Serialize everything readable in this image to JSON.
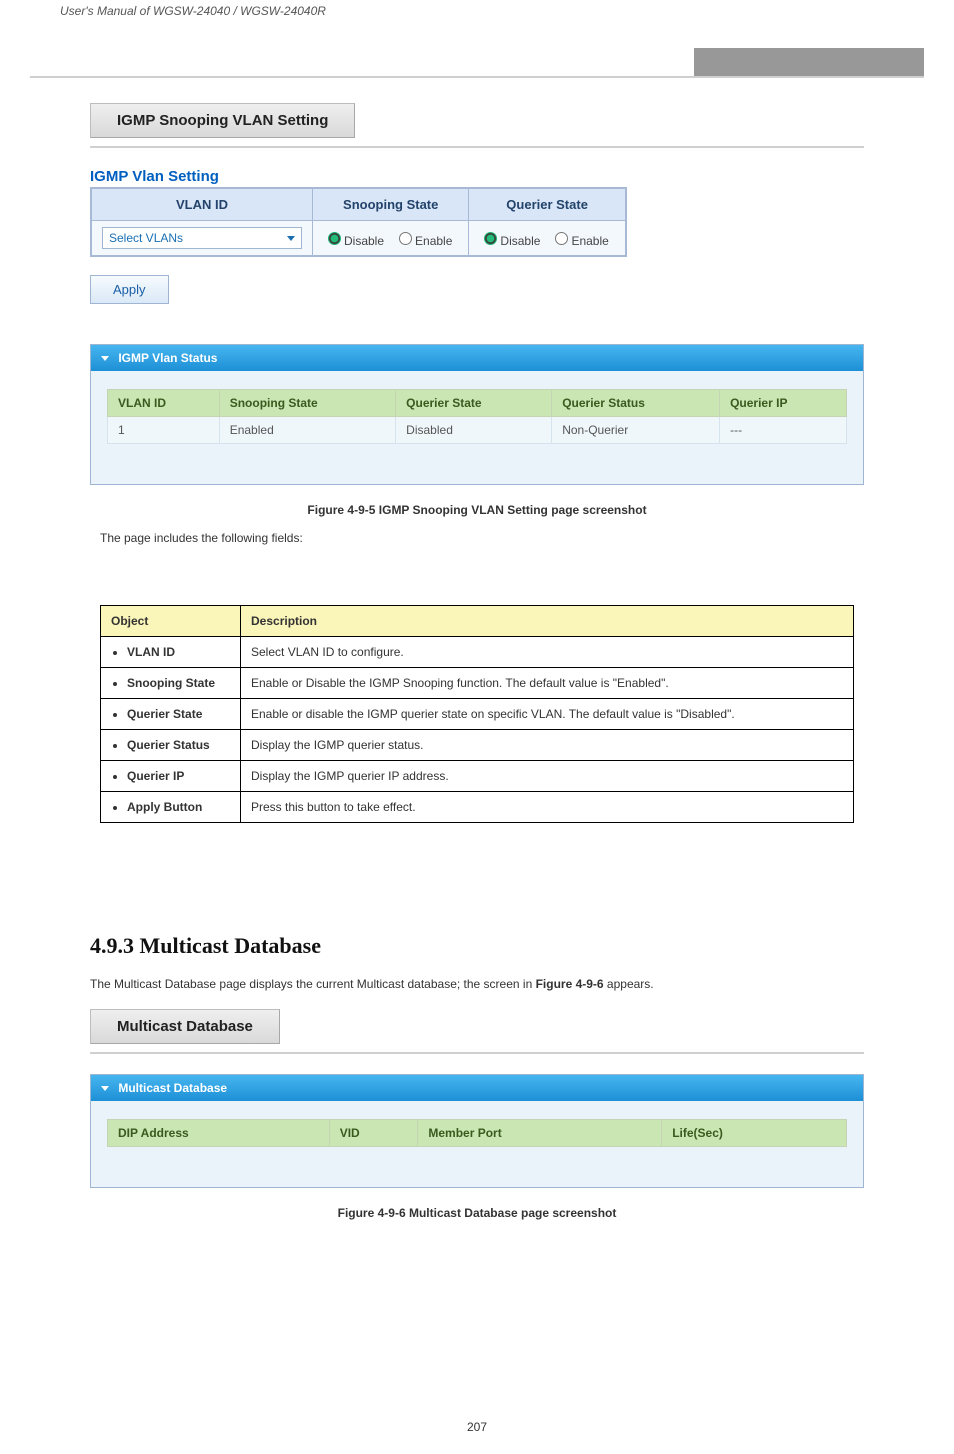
{
  "doc_title_italic": "User's Manual of WGSW-24040 / WGSW-24040R",
  "section1": {
    "title": "IGMP Snooping VLAN Setting",
    "form_title": "IGMP Vlan Setting",
    "headers": {
      "vlan_id": "VLAN ID",
      "snooping": "Snooping State",
      "querier": "Querier State"
    },
    "select_placeholder": "Select VLANs",
    "radio": {
      "disable": "Disable",
      "enable": "Enable"
    },
    "apply": "Apply",
    "status_panel_title": "IGMP Vlan Status",
    "status_headers": {
      "vlan_id": "VLAN ID",
      "snooping": "Snooping State",
      "querier": "Querier State",
      "qstatus": "Querier Status",
      "qip": "Querier IP"
    },
    "status_row": {
      "vlan_id": "1",
      "snooping": "Enabled",
      "querier": "Disabled",
      "qstatus": "Non-Querier",
      "qip": "---"
    },
    "figure_caption": "Figure 4-9-5 IGMP Snooping VLAN Setting page screenshot",
    "lead_in": "The page includes the following fields:"
  },
  "obj_table": {
    "head": {
      "obj": "Object",
      "desc": "Description"
    },
    "rows": [
      {
        "obj": "VLAN ID",
        "desc_prefix": "Select ",
        "desc_link": "VLAN",
        "desc_suffix": " ID to configure."
      },
      {
        "obj": "Snooping State",
        "desc": "Enable or Disable the IGMP Snooping function. The default value is \"Enabled\"."
      },
      {
        "obj": "Querier State",
        "desc": "Enable or disable the IGMP querier state on specific VLAN. The default value is \"Disabled\"."
      },
      {
        "obj": "Querier Status",
        "desc": "Display the IGMP querier status."
      },
      {
        "obj": "Querier IP",
        "desc": "Display the IGMP querier IP address."
      },
      {
        "obj": "Apply Button",
        "desc": "Press this button to take effect."
      }
    ]
  },
  "section2": {
    "number": "4.9.3",
    "title": "Multicast Database",
    "lead": "The Multicast Database page displays the current Multicast database; the screen in ",
    "fig_ref": "Figure 4-9-6",
    "lead_tail": " appears.",
    "panel_title": "Multicast Database",
    "headers": {
      "dip": "DIP Address",
      "vid": "VID",
      "member": "Member Port",
      "life": "Life(Sec)"
    },
    "figure_caption": "Figure 4-9-6 Multicast Database page screenshot"
  },
  "footer_page": "207"
}
